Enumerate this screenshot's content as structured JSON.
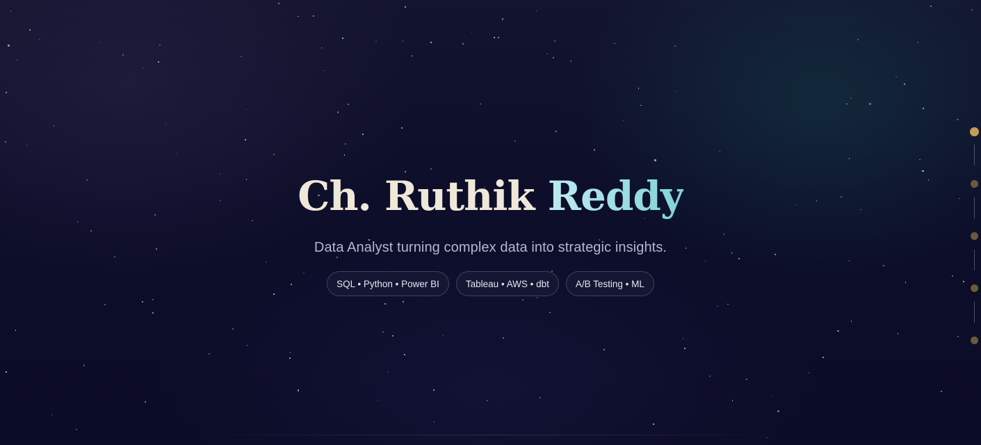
{
  "hero": {
    "name_first": "Ch. Ruthik",
    "name_last": "Reddy",
    "tagline": "Data Analyst turning complex data into strategic insights.",
    "chips": [
      "SQL • Python • Power BI",
      "Tableau • AWS • dbt",
      "A/B Testing • ML"
    ]
  },
  "colors": {
    "background": "#0c0d24",
    "name_first": "#efe8d8",
    "name_last_accent": "#7fd3d6",
    "nav_dot_active": "#c79a58",
    "nav_dot": "#6b5a38"
  },
  "section_nav": {
    "dots": 5,
    "active_index": 0
  }
}
